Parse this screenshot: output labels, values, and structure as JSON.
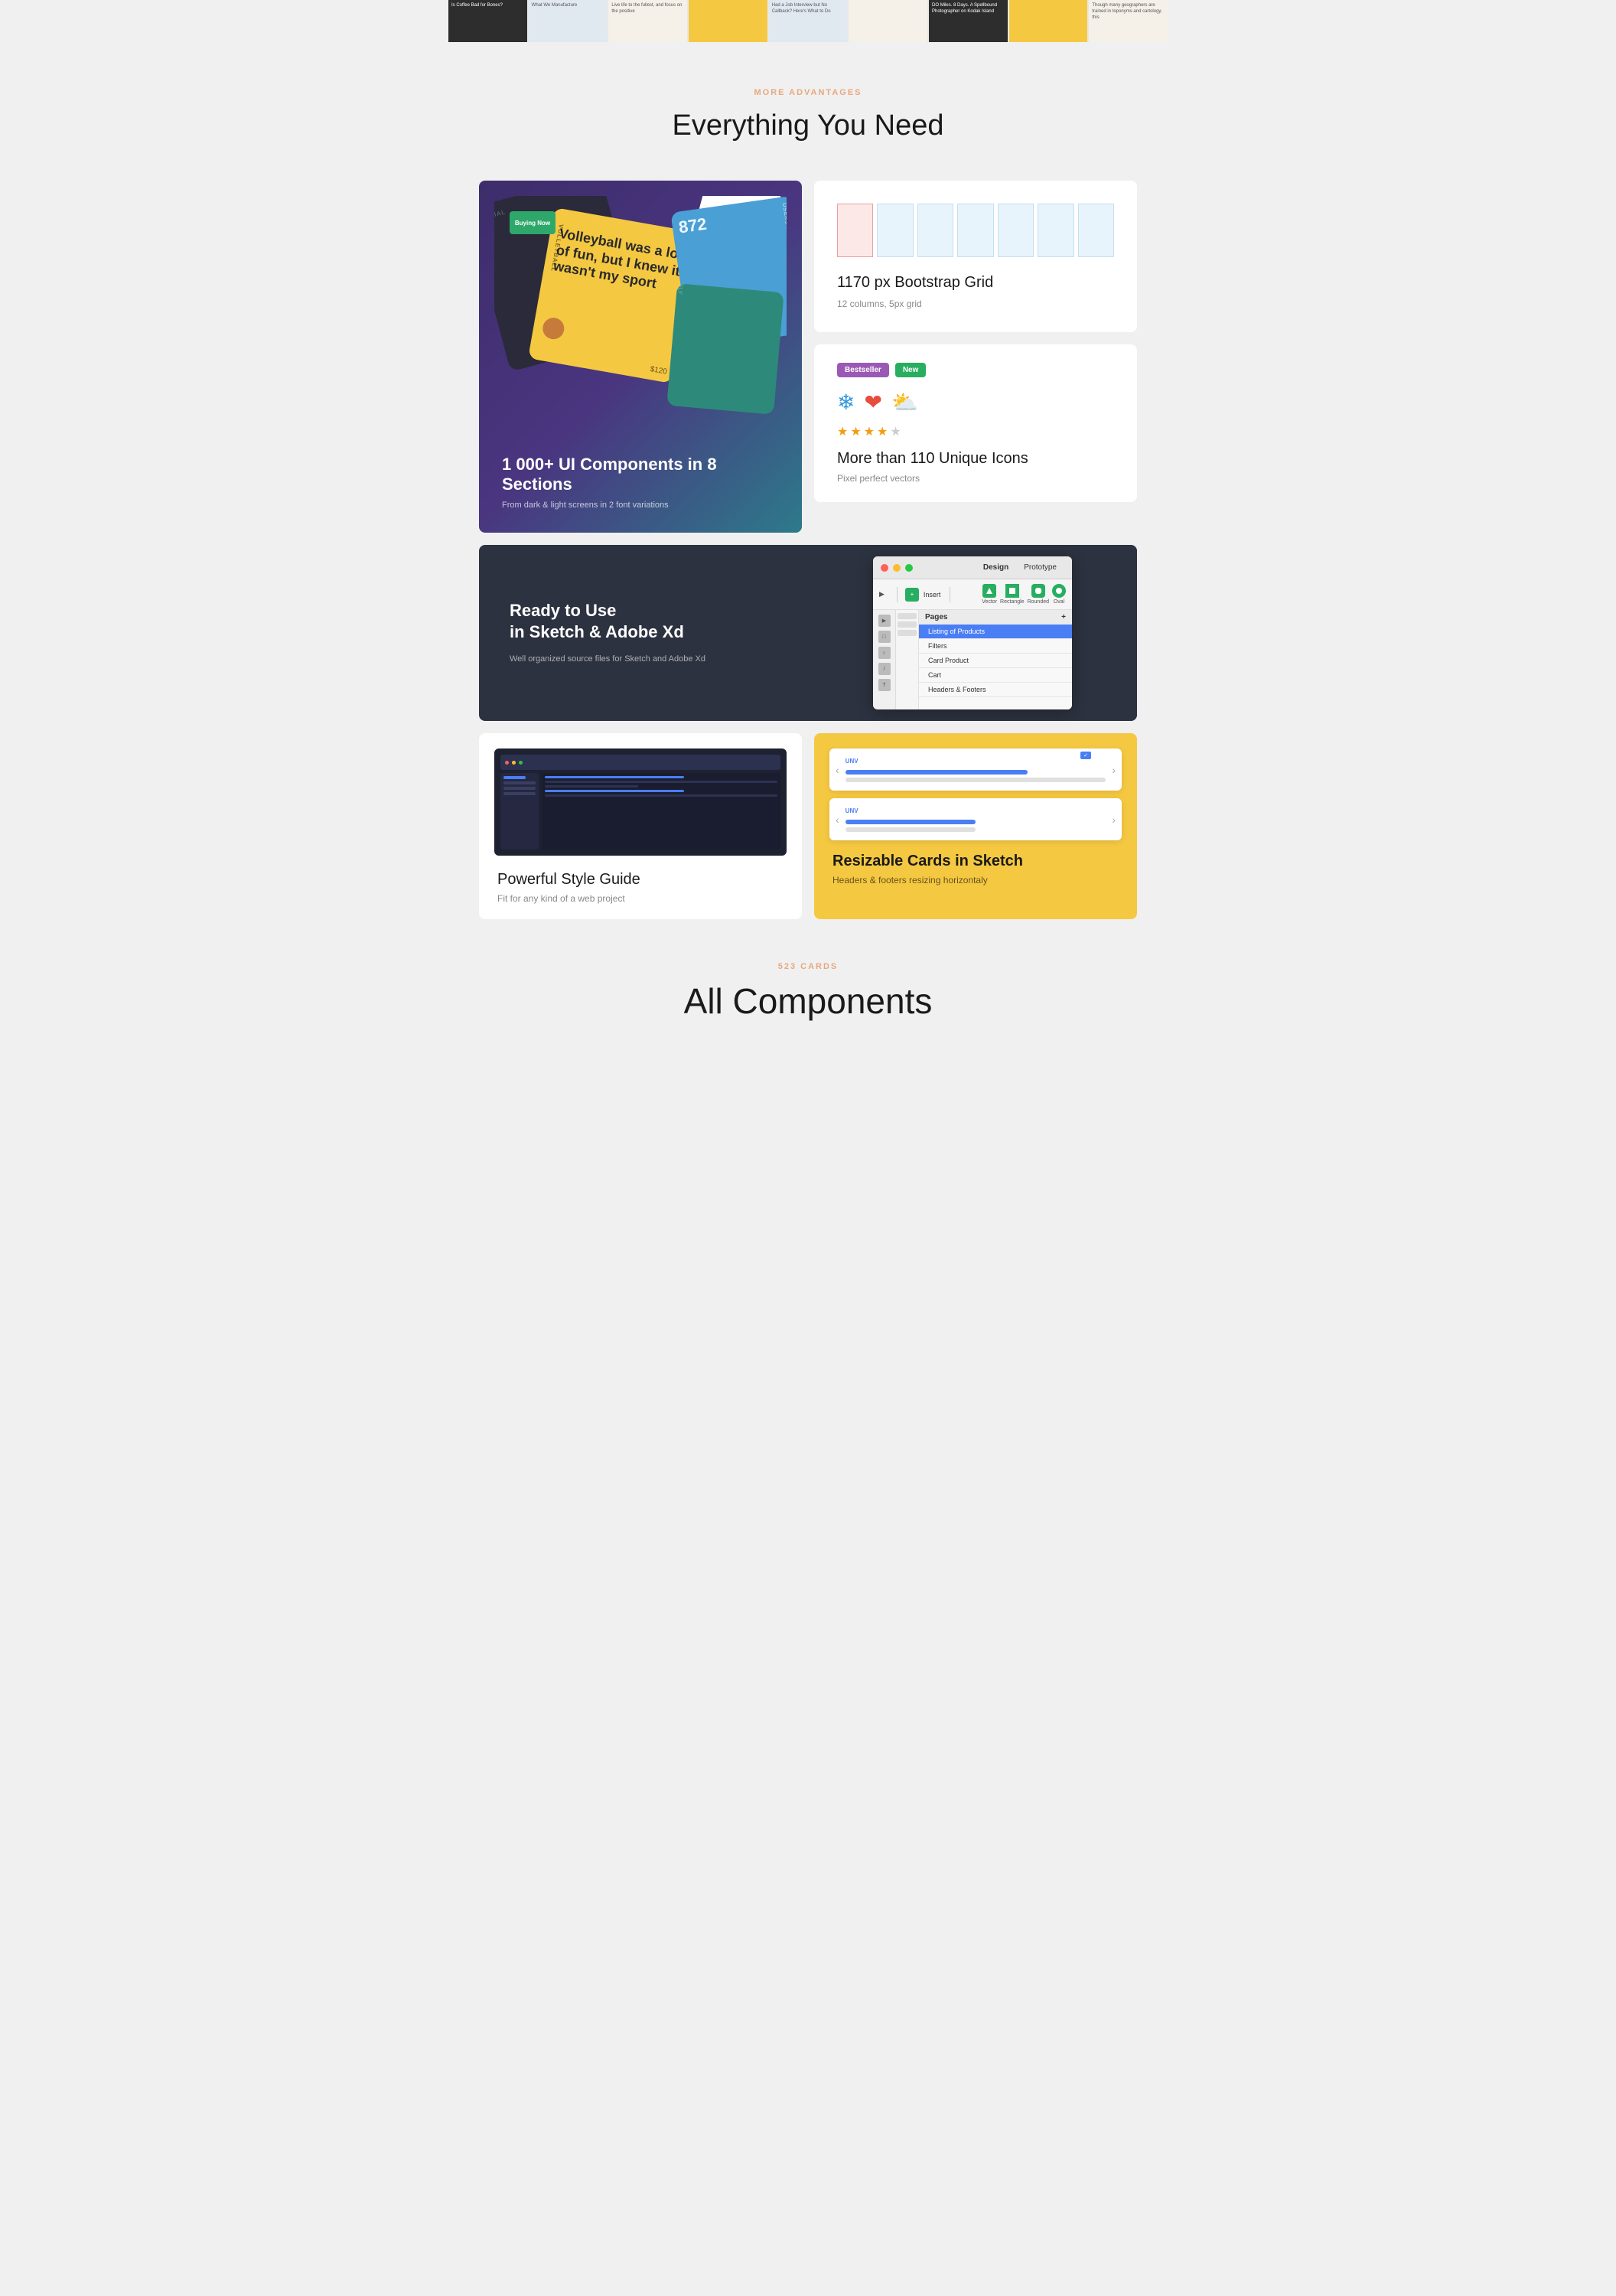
{
  "topStrip": {
    "items": [
      {
        "type": "dark",
        "text": "Is Coffee Bad for Bones?"
      },
      {
        "type": "light",
        "text": "What We Manufacture"
      },
      {
        "type": "cream",
        "text": "Live life to the fullest, and focus on the positive"
      },
      {
        "type": "yellow",
        "text": ""
      },
      {
        "type": "light",
        "text": "Had a Job Interview but No Callback? Here's What to Do"
      },
      {
        "type": "cream",
        "text": ""
      },
      {
        "type": "dark",
        "text": "DO Miles. 8 Days. 'A Spellbound Photographer on Kodak Island'"
      },
      {
        "type": "yellow",
        "text": ""
      },
      {
        "type": "cream",
        "text": "Though many geographers are trained in toponyms and cartology, this"
      }
    ]
  },
  "section": {
    "label": "MORE ADVANTAGES",
    "title": "Everything You Need"
  },
  "uiCard": {
    "volleyballText": "Volleyball was a lot of fun, but I knew it wasn't my sport",
    "codeNumber": "872",
    "usersTag": "USERS RIGHT NOW",
    "price": "$120",
    "volleyball": "VOLLEYBALL",
    "title": "1 000+ UI Components in 8 Sections",
    "description": "From dark & light screens in 2 font variations"
  },
  "bootstrapCard": {
    "title": "1170 px Bootstrap Grid",
    "description": "12 columns, 5px grid"
  },
  "iconsCard": {
    "badges": [
      {
        "label": "Bestseller",
        "color": "purple"
      },
      {
        "label": "New",
        "color": "green"
      }
    ],
    "title": "More than 110 Unique Icons",
    "description": "Pixel perfect vectors",
    "stars": 4.5
  },
  "sketchCard": {
    "title": "Ready to Use\nin Sketch & Adobe Xd",
    "description": "Well organized source files for Sketch and Adobe Xd",
    "ui": {
      "tabs": [
        "Design",
        "Prototype"
      ],
      "tools": [
        "Insert",
        "Vector",
        "Rectangle",
        "Rounded",
        "Oval"
      ],
      "pages": "Pages",
      "pageItems": [
        "Listing of Products",
        "Filters",
        "Card Product",
        "Cart",
        "Headers & Footers"
      ]
    }
  },
  "styleGuideCard": {
    "title": "Powerful Style Guide",
    "description": "Fit for any kind of a web project"
  },
  "resizableCard": {
    "title": "Resizable Cards in Sketch",
    "description": "Headers & footers resizing horizontaly",
    "label1": "UNV",
    "label2": "UNV"
  },
  "bottomSection": {
    "label": "523 CARDS",
    "title": "All Components"
  }
}
